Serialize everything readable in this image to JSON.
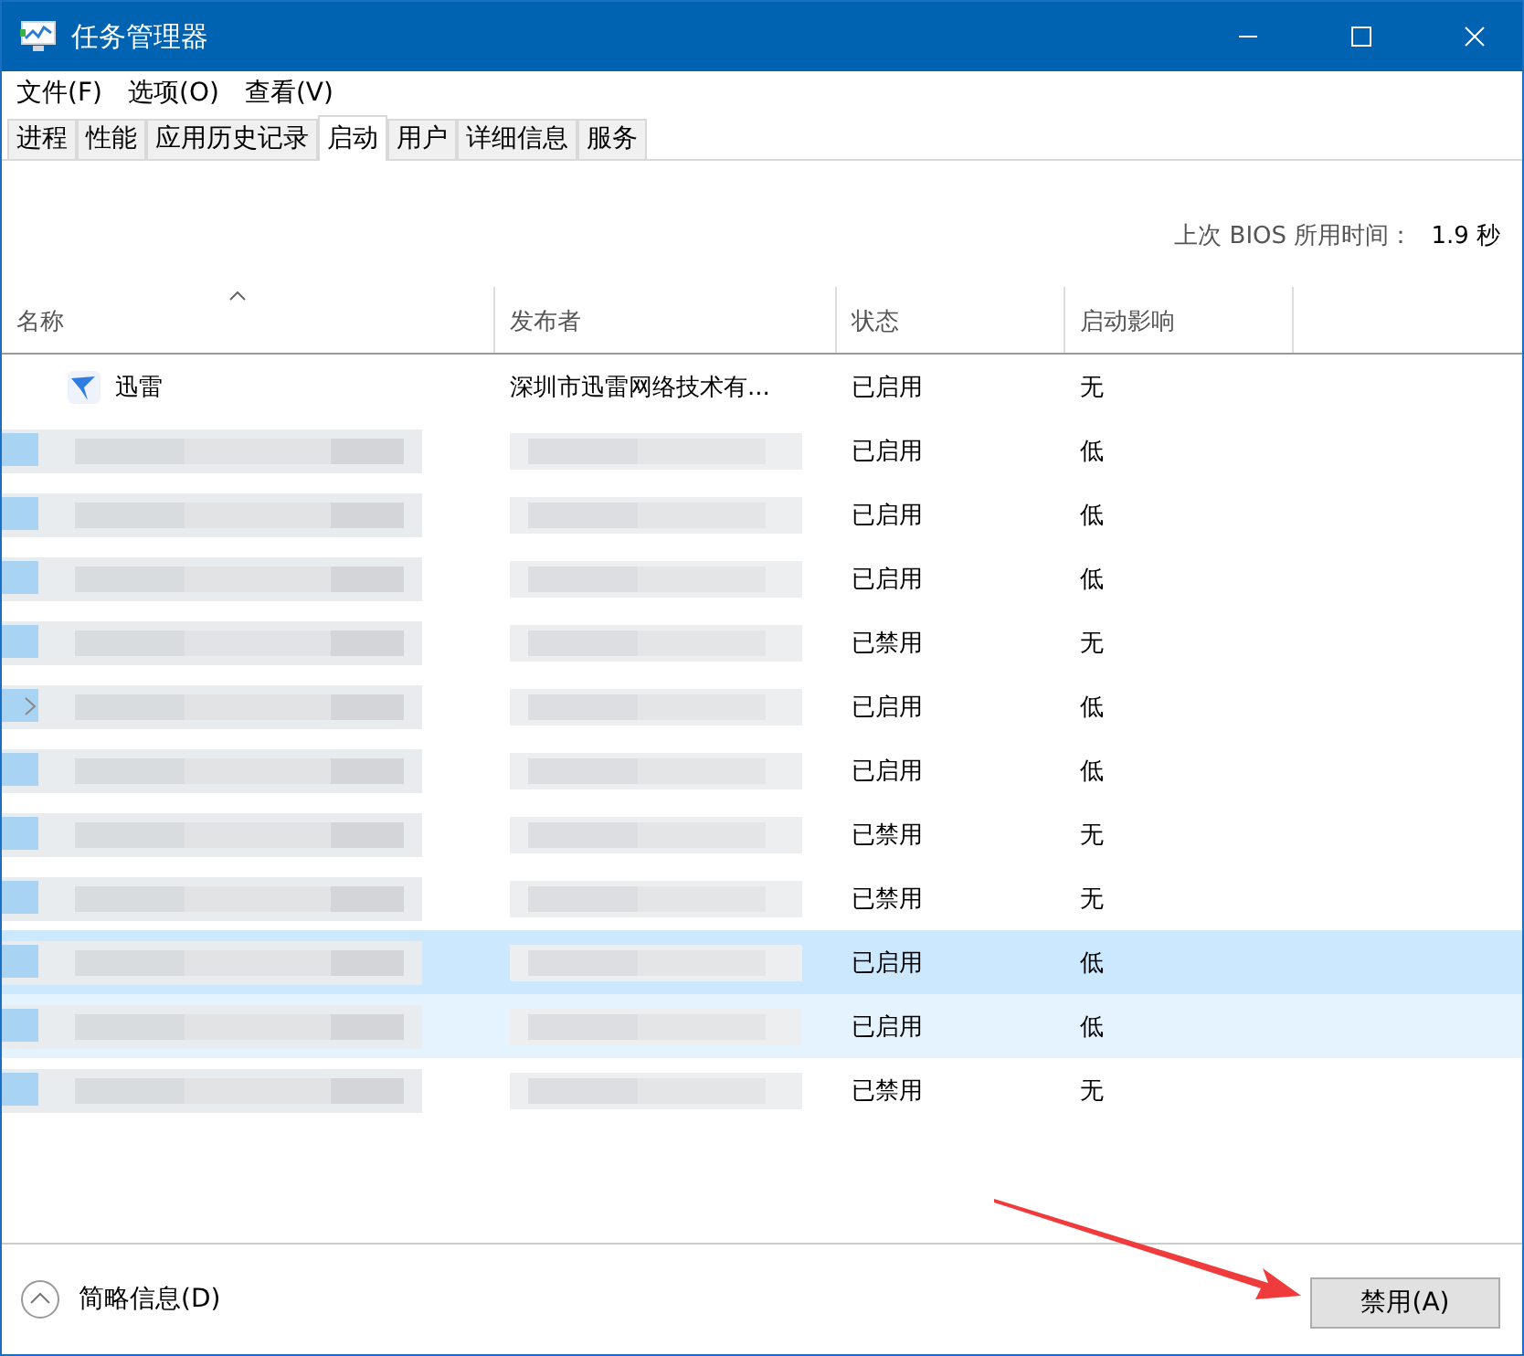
{
  "window": {
    "title": "任务管理器"
  },
  "menu": [
    "文件(F)",
    "选项(O)",
    "查看(V)"
  ],
  "tabs": [
    {
      "label": "进程",
      "selected": false
    },
    {
      "label": "性能",
      "selected": false
    },
    {
      "label": "应用历史记录",
      "selected": false
    },
    {
      "label": "启动",
      "selected": true
    },
    {
      "label": "用户",
      "selected": false
    },
    {
      "label": "详细信息",
      "selected": false
    },
    {
      "label": "服务",
      "selected": false
    }
  ],
  "bios": {
    "label": "上次 BIOS 所用时间：",
    "value": "1.9 秒"
  },
  "table": {
    "columns": [
      "名称",
      "发布者",
      "状态",
      "启动影响"
    ],
    "rows": [
      {
        "kind": "app",
        "name": "迅雷",
        "publisher": "深圳市迅雷网络技术有...",
        "status": "已启用",
        "impact": "无",
        "selected": false,
        "hovered": false,
        "expandable": false
      },
      {
        "kind": "redacted",
        "status": "已启用",
        "impact": "低",
        "selected": false,
        "hovered": false,
        "expandable": false
      },
      {
        "kind": "redacted",
        "status": "已启用",
        "impact": "低",
        "selected": false,
        "hovered": false,
        "expandable": false
      },
      {
        "kind": "redacted",
        "status": "已启用",
        "impact": "低",
        "selected": false,
        "hovered": false,
        "expandable": false
      },
      {
        "kind": "redacted",
        "status": "已禁用",
        "impact": "无",
        "selected": false,
        "hovered": false,
        "expandable": false
      },
      {
        "kind": "redacted",
        "status": "已启用",
        "impact": "低",
        "selected": false,
        "hovered": false,
        "expandable": true
      },
      {
        "kind": "redacted",
        "status": "已启用",
        "impact": "低",
        "selected": false,
        "hovered": false,
        "expandable": false
      },
      {
        "kind": "redacted",
        "status": "已禁用",
        "impact": "无",
        "selected": false,
        "hovered": false,
        "expandable": false
      },
      {
        "kind": "redacted",
        "status": "已禁用",
        "impact": "无",
        "selected": false,
        "hovered": false,
        "expandable": false
      },
      {
        "kind": "redacted",
        "status": "已启用",
        "impact": "低",
        "selected": true,
        "hovered": false,
        "expandable": false
      },
      {
        "kind": "redacted",
        "status": "已启用",
        "impact": "低",
        "selected": false,
        "hovered": true,
        "expandable": false
      },
      {
        "kind": "redacted",
        "status": "已禁用",
        "impact": "无",
        "selected": false,
        "hovered": false,
        "expandable": false
      }
    ]
  },
  "footer": {
    "details": "简略信息(D)",
    "button": "禁用(A)"
  }
}
